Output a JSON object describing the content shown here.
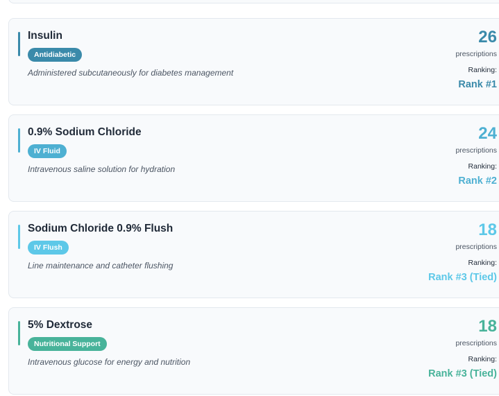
{
  "cards": [
    {
      "title": "Insulin",
      "badge": "Antidiabetic",
      "description": "Administered subcutaneously for diabetes management",
      "count": "26",
      "count_label": "prescriptions",
      "ranking_label": "Ranking:",
      "rank": "Rank #1",
      "color": "#3a8aaa"
    },
    {
      "title": "0.9% Sodium Chloride",
      "badge": "IV Fluid",
      "description": "Intravenous saline solution for hydration",
      "count": "24",
      "count_label": "prescriptions",
      "ranking_label": "Ranking:",
      "rank": "Rank #2",
      "color": "#4eb0d2"
    },
    {
      "title": "Sodium Chloride 0.9% Flush",
      "badge": "IV Flush",
      "description": "Line maintenance and catheter flushing",
      "count": "18",
      "count_label": "prescriptions",
      "ranking_label": "Ranking:",
      "rank": "Rank #3 (Tied)",
      "color": "#5dc8e8"
    },
    {
      "title": "5% Dextrose",
      "badge": "Nutritional Support",
      "description": "Intravenous glucose for energy and nutrition",
      "count": "18",
      "count_label": "prescriptions",
      "ranking_label": "Ranking:",
      "rank": "Rank #3 (Tied)",
      "color": "#48b39a"
    }
  ]
}
